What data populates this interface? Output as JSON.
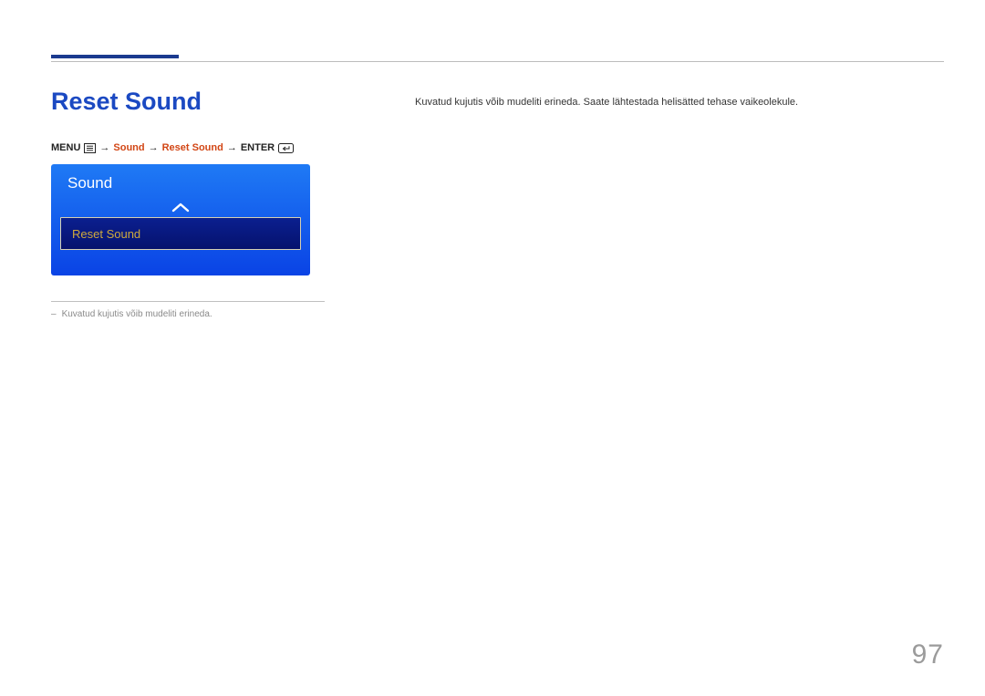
{
  "heading": "Reset Sound",
  "body_text": "Kuvatud kujutis võib mudeliti erineda. Saate lähtestada helisätted tehase vaikeolekule.",
  "breadcrumb": {
    "menu": "MENU",
    "sound": "Sound",
    "reset_sound": "Reset Sound",
    "enter": "ENTER",
    "arrow": "→"
  },
  "osd": {
    "title": "Sound",
    "selected_item": "Reset Sound"
  },
  "footnote": {
    "dash": "–",
    "text": "Kuvatud kujutis võib mudeliti erineda."
  },
  "page_number": "97"
}
